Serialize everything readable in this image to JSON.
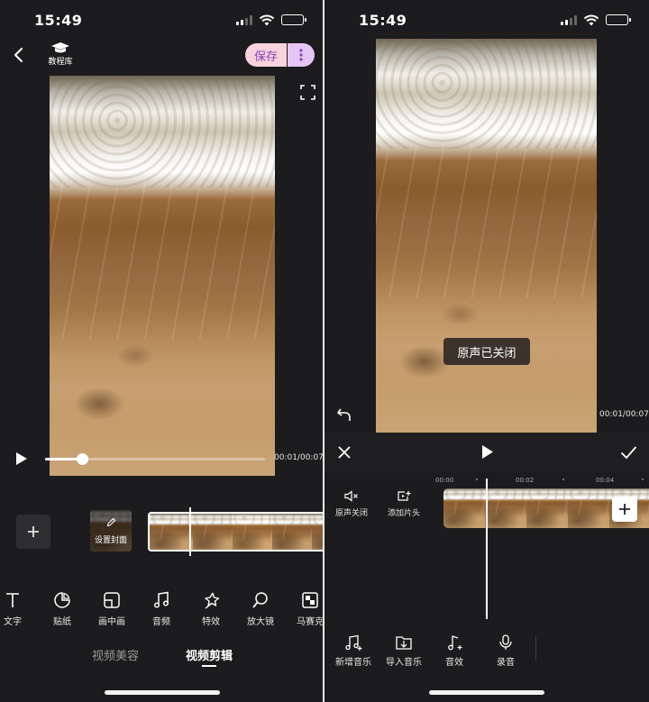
{
  "status_bar": {
    "time": "15:49"
  },
  "left": {
    "header": {
      "tutorial_label": "教程库",
      "save_label": "保存"
    },
    "player": {
      "time_readout": "00:01/00:07",
      "progress": 0.17
    },
    "timeline": {
      "cover_label": "设置封面"
    },
    "tools": [
      {
        "label": "文字",
        "icon": "text-icon"
      },
      {
        "label": "贴纸",
        "icon": "sticker-icon"
      },
      {
        "label": "画中画",
        "icon": "pip-icon"
      },
      {
        "label": "音频",
        "icon": "music-icon"
      },
      {
        "label": "特效",
        "icon": "effects-icon"
      },
      {
        "label": "放大镜",
        "icon": "magnifier-icon"
      },
      {
        "label": "马赛克",
        "icon": "mosaic-icon"
      }
    ],
    "bottom_tabs": [
      {
        "label": "视频美容",
        "active": false
      },
      {
        "label": "视频剪辑",
        "active": true
      }
    ]
  },
  "right": {
    "player": {
      "toast": "原声已关闭",
      "time_readout": "00:01/00:07"
    },
    "timeline": {
      "ruler": [
        "00:00",
        "00:02",
        "00:04"
      ],
      "mute_label": "原声关闭",
      "add_intro_label": "添加片头"
    },
    "audio_tools": [
      {
        "label": "新增音乐",
        "icon": "add-music-icon"
      },
      {
        "label": "导入音乐",
        "icon": "import-music-icon"
      },
      {
        "label": "音效",
        "icon": "sound-effect-icon"
      },
      {
        "label": "录音",
        "icon": "microphone-icon"
      }
    ]
  },
  "colors": {
    "background": "#1c1c1e",
    "save_button_bg": "#f7d3dc",
    "more_button_bg": "#e4c6f2",
    "accent_purple": "#8b3fb8"
  }
}
